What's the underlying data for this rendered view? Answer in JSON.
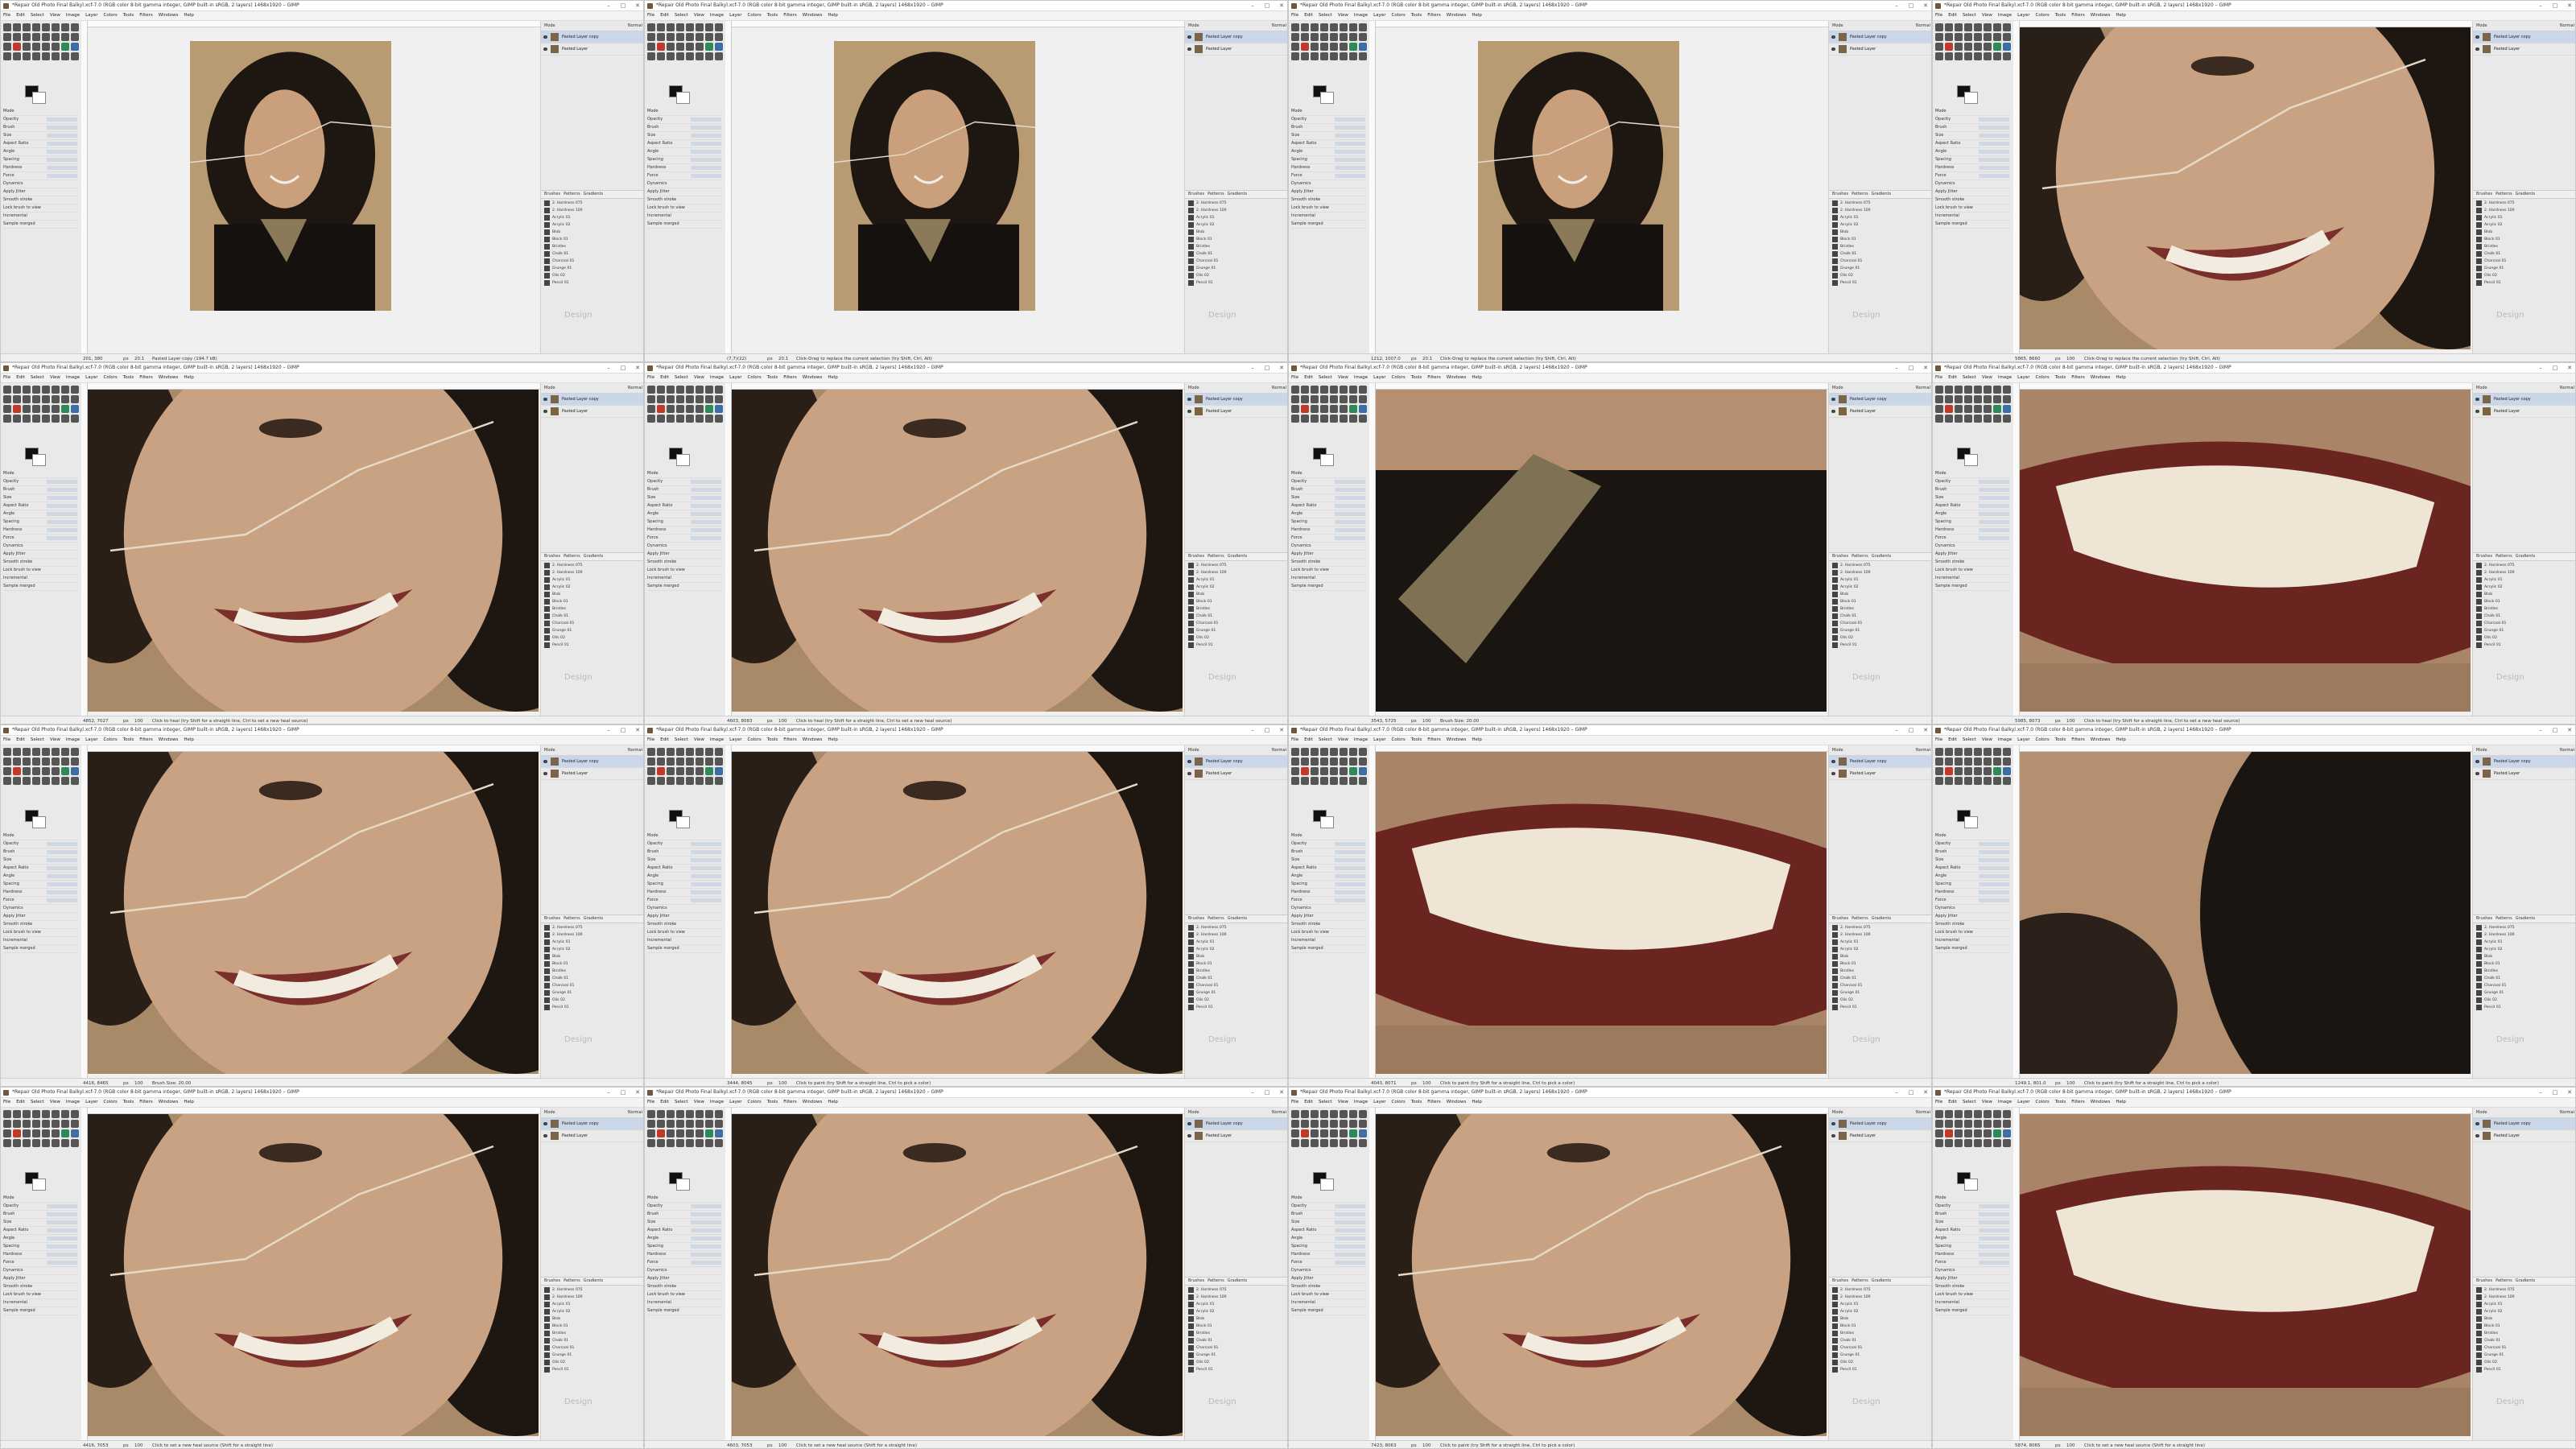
{
  "window_title": "*Repair Old Photo Final Balkyl.xcf-7.0 (RGB color 8-bit gamma integer, GIMP built-in sRGB, 2 layers) 1468x1920 – GIMP",
  "menu_items": [
    "File",
    "Edit",
    "Select",
    "View",
    "Image",
    "Layer",
    "Colors",
    "Tools",
    "Filters",
    "Windows",
    "Help"
  ],
  "window_buttons": [
    "–",
    "□",
    "✕"
  ],
  "dock": {
    "mode_label": "Mode",
    "mode_value": "Normal",
    "layers": [
      "Pasted Layer copy",
      "Pasted Layer"
    ],
    "tabs": [
      "Brushes",
      "Patterns",
      "Gradients"
    ],
    "brushes": [
      "2. Hardness 075",
      "2. Hardness 100",
      "Acrylic 01",
      "Acrylic 02",
      "Blob",
      "Block 01",
      "Bristles",
      "Chalk 01",
      "Charcoal 01",
      "Grunge 01",
      "Oils 02",
      "Pencil 01"
    ]
  },
  "tool_options": [
    "Mode",
    "Opacity",
    "Brush",
    "Size",
    "Aspect Ratio",
    "Angle",
    "Spacing",
    "Hardness",
    "Force",
    "Dynamics",
    "Apply Jitter",
    "Smooth stroke",
    "Lock brush to view",
    "Incremental",
    "Sample merged"
  ],
  "watermark": "Design",
  "panels": [
    {
      "coords": "201, 380",
      "unit": "px",
      "zoom": "20.1",
      "message": "Pasted Layer copy (194.7 kB)",
      "view": "full"
    },
    {
      "coords": "(7,7)(22)",
      "unit": "px",
      "zoom": "20.1",
      "message": "Click-Drag to replace the current selection (try Shift, Ctrl, Alt)",
      "view": "full"
    },
    {
      "coords": "1212, 1007.0",
      "unit": "px",
      "zoom": "20.1",
      "message": "Click-Drag to replace the current selection (try Shift, Ctrl, Alt)",
      "view": "full"
    },
    {
      "coords": "5865, 8660",
      "unit": "px",
      "zoom": "100",
      "message": "Click-Drag to replace the current selection (try Shift, Ctrl, Alt)",
      "view": "face"
    },
    {
      "coords": "4852, 7027",
      "unit": "px",
      "zoom": "100",
      "message": "Click to heal (try Shift for a straight line, Ctrl to set a new heal source)",
      "view": "face"
    },
    {
      "coords": "4603, 8083",
      "unit": "px",
      "zoom": "100",
      "message": "Click to heal (try Shift for a straight line, Ctrl to set a new heal source)",
      "view": "face"
    },
    {
      "coords": "3543, 5725",
      "unit": "px",
      "zoom": "100",
      "message": "Brush Size: 20.00",
      "view": "collar"
    },
    {
      "coords": "5985, 8073",
      "unit": "px",
      "zoom": "100",
      "message": "Click to heal (try Shift for a straight line, Ctrl to set a new heal source)",
      "view": "mouth"
    },
    {
      "coords": "4416, 8465",
      "unit": "px",
      "zoom": "100",
      "message": "Brush Size: 20.00",
      "view": "face"
    },
    {
      "coords": "3444, 8045",
      "unit": "px",
      "zoom": "100",
      "message": "Click to paint (try Shift for a straight line, Ctrl to pick a color)",
      "view": "face"
    },
    {
      "coords": "4043, 8071",
      "unit": "px",
      "zoom": "100",
      "message": "Click to paint (try Shift for a straight line, Ctrl to pick a color)",
      "view": "mouth"
    },
    {
      "coords": "1249.1, 801.0",
      "unit": "px",
      "zoom": "100",
      "message": "Click to paint (try Shift for a straight line, Ctrl to pick a color)",
      "view": "hair"
    },
    {
      "coords": "4416, 7053",
      "unit": "px",
      "zoom": "100",
      "message": "Click to set a new heal source (Shift for a straight line)",
      "view": "face"
    },
    {
      "coords": "4603, 7053",
      "unit": "px",
      "zoom": "100",
      "message": "Click to set a new heal source (Shift for a straight line)",
      "view": "face"
    },
    {
      "coords": "7423, 8063",
      "unit": "px",
      "zoom": "100",
      "message": "Click to paint (try Shift for a straight line, Ctrl to pick a color)",
      "view": "face"
    },
    {
      "coords": "5874, 8065",
      "unit": "px",
      "zoom": "100",
      "message": "Click to set a new heal source (Shift for a straight line)",
      "view": "mouth"
    }
  ]
}
